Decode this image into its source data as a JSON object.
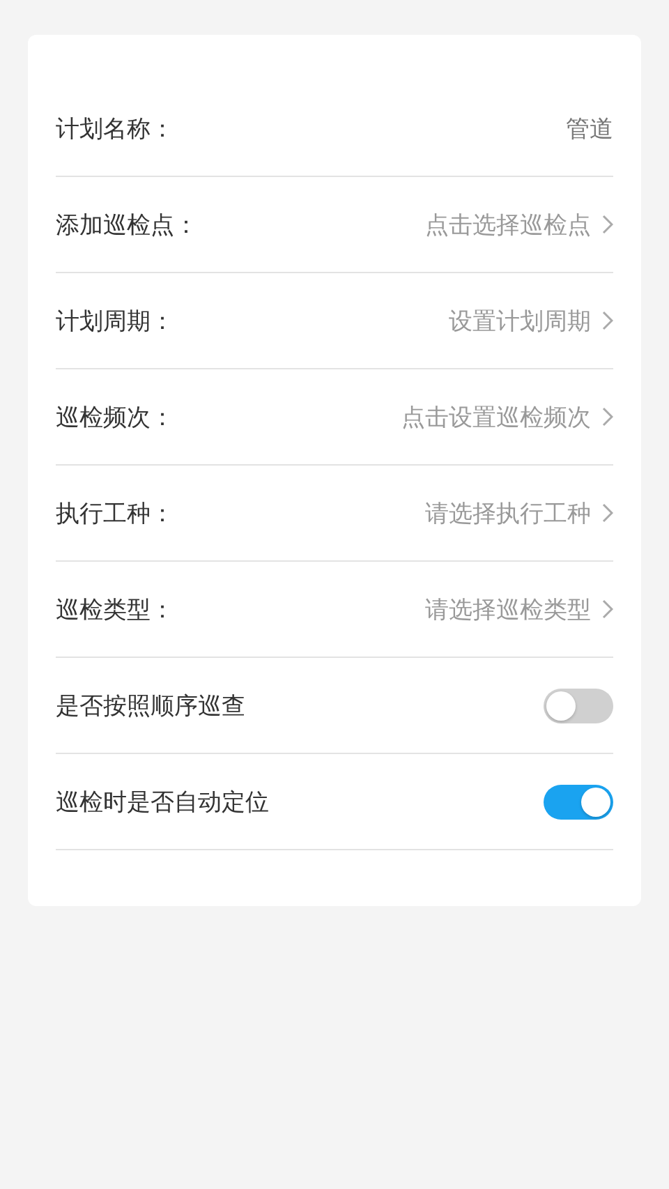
{
  "form": {
    "rows": [
      {
        "kind": "input",
        "label": "计划名称：",
        "value": "管道"
      },
      {
        "kind": "select",
        "label": "添加巡检点：",
        "placeholder": "点击选择巡检点"
      },
      {
        "kind": "select",
        "label": "计划周期：",
        "placeholder": "设置计划周期"
      },
      {
        "kind": "select",
        "label": "巡检频次：",
        "placeholder": "点击设置巡检频次"
      },
      {
        "kind": "select",
        "label": "执行工种：",
        "placeholder": "请选择执行工种"
      },
      {
        "kind": "select",
        "label": "巡检类型：",
        "placeholder": "请选择巡检类型"
      },
      {
        "kind": "toggle",
        "label": "是否按照顺序巡查",
        "on": false
      },
      {
        "kind": "toggle",
        "label": "巡检时是否自动定位",
        "on": true
      }
    ]
  }
}
